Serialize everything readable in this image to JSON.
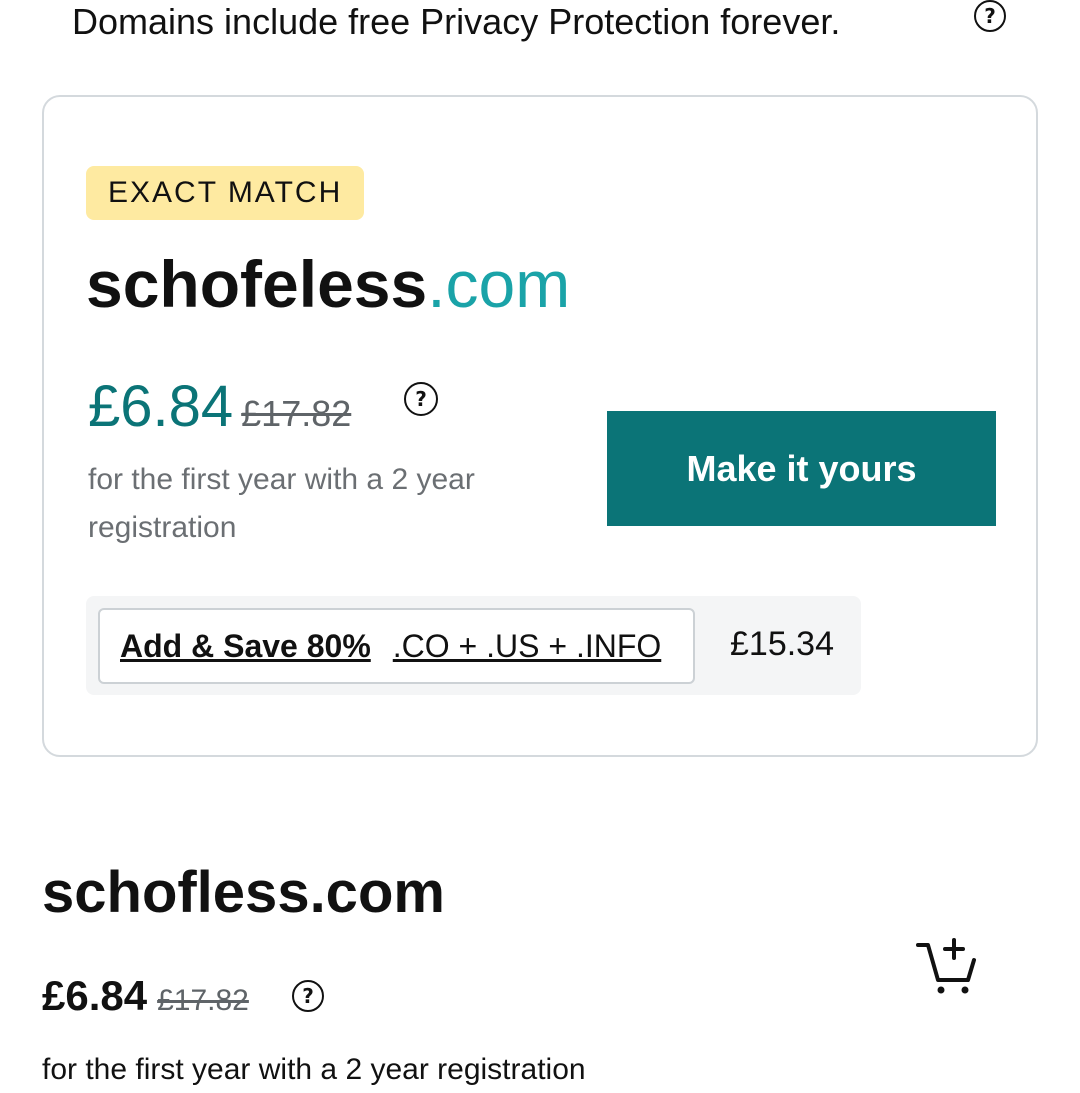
{
  "header": {
    "privacy_text": "Domains include free Privacy Protection forever.",
    "help_glyph": "?"
  },
  "exact_match": {
    "badge": "EXACT MATCH",
    "domain_name": "schofeless",
    "domain_tld": ".com",
    "price": "£6.84",
    "old_price": "£17.82",
    "help_glyph": "?",
    "price_note": "for the first year with a 2 year registration",
    "cta_label": "Make it yours",
    "bundle": {
      "save_label": "Add & Save 80%",
      "tlds": ".CO + .US + .INFO",
      "price": "£15.34"
    }
  },
  "result_2": {
    "domain": "schofless.com",
    "price": "£6.84",
    "old_price": "£17.82",
    "help_glyph": "?",
    "price_note": "for the first year with a 2 year registration",
    "cart_icon": "add-to-cart-icon"
  },
  "colors": {
    "accent": "#0b7477",
    "tld": "#1aa3a8",
    "badge": "#feeaa1",
    "border": "#d4d9dd"
  }
}
